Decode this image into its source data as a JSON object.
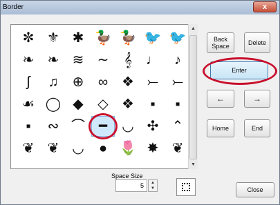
{
  "window": {
    "title": "Border",
    "close_glyph": "x"
  },
  "glyph_rows": [
    [
      "✼",
      "⚜",
      "✱",
      "🦆",
      "🦆",
      "🐦",
      "🐦"
    ],
    [
      "❧",
      "❧",
      "≋",
      "∼",
      "𝄞",
      "♩",
      "♪"
    ],
    [
      "ʃ",
      "♫",
      "⊕",
      "∞",
      "❖",
      "⤚",
      "⤚"
    ],
    [
      "☙",
      "◯",
      "◆",
      "◇",
      "❖",
      "▪",
      "▪"
    ],
    [
      "▪",
      "∾",
      "⌒",
      "━",
      "◡",
      "✣",
      "⌃"
    ],
    [
      "❦",
      "❦",
      "◡",
      "●",
      "🌷",
      "✸",
      "❦"
    ]
  ],
  "selected_glyph": {
    "row": 4,
    "col": 3
  },
  "buttons": {
    "backspace": "Back Space",
    "delete": "Delete",
    "enter": "Enter",
    "left": "←",
    "right": "→",
    "home": "Home",
    "end": "End",
    "close": "Close"
  },
  "space_size": {
    "label": "Space Size",
    "value": "5"
  },
  "colors": {
    "highlight_ring": "#c8102e",
    "enter_face": "#c8e5f7"
  }
}
